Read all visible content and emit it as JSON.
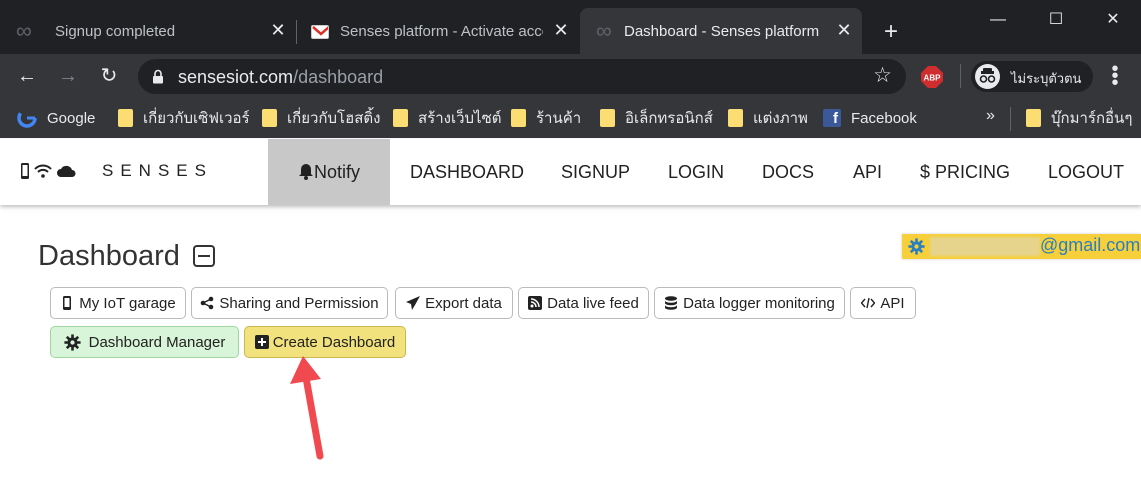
{
  "browser": {
    "tabs": [
      {
        "title": "Signup completed"
      },
      {
        "title": "Senses platform - Activate acco"
      },
      {
        "title": "Dashboard - Senses platform |"
      }
    ],
    "url_host": "sensesiot.com",
    "url_path": "/dashboard",
    "profile_label": "ไม่ระบุตัวตน",
    "abp_label": "ABP"
  },
  "bookmarks": [
    {
      "label": "Google",
      "icon": "google-icon"
    },
    {
      "label": "เกี่ยวกับเซิฟเวอร์",
      "icon": "folder-icon"
    },
    {
      "label": "เกี่ยวกับโฮสติ้ง",
      "icon": "folder-icon"
    },
    {
      "label": "สร้างเว็บไซต์",
      "icon": "folder-icon"
    },
    {
      "label": "ร้านค้า",
      "icon": "folder-icon"
    },
    {
      "label": "อิเล็กทรอนิกส์",
      "icon": "folder-icon"
    },
    {
      "label": "แต่งภาพ",
      "icon": "folder-icon"
    },
    {
      "label": "Facebook",
      "icon": "facebook-icon"
    },
    {
      "label": "»"
    },
    {
      "label": "บุ๊กมาร์กอื่นๆ",
      "icon": "folder-icon"
    }
  ],
  "site": {
    "brand": "SENSES",
    "nav": {
      "notify": "Notify",
      "dashboard": "DASHBOARD",
      "signup": "SIGNUP",
      "login": "LOGIN",
      "docs": "DOCS",
      "api": "API",
      "pricing": "$ PRICING",
      "logout": "LOGOUT"
    },
    "user_email_suffix": "@gmail.com"
  },
  "dashboard": {
    "title": "Dashboard",
    "buttons": {
      "garage": "My IoT garage",
      "sharing": "Sharing and Permission",
      "export": "Export data",
      "livefeed": "Data live feed",
      "logger": "Data logger monitoring",
      "api": "API",
      "manager": "Dashboard Manager",
      "create": "Create Dashboard"
    }
  },
  "colors": {
    "chrome_dark": "#202124",
    "chrome_toolbar": "#35363a",
    "notify_bg": "#c8c8c8",
    "email_badge": "#f6cf3a",
    "create_btn": "#f2e27d",
    "manager_btn": "#d9f5d9",
    "arrow": "#f0494f"
  }
}
